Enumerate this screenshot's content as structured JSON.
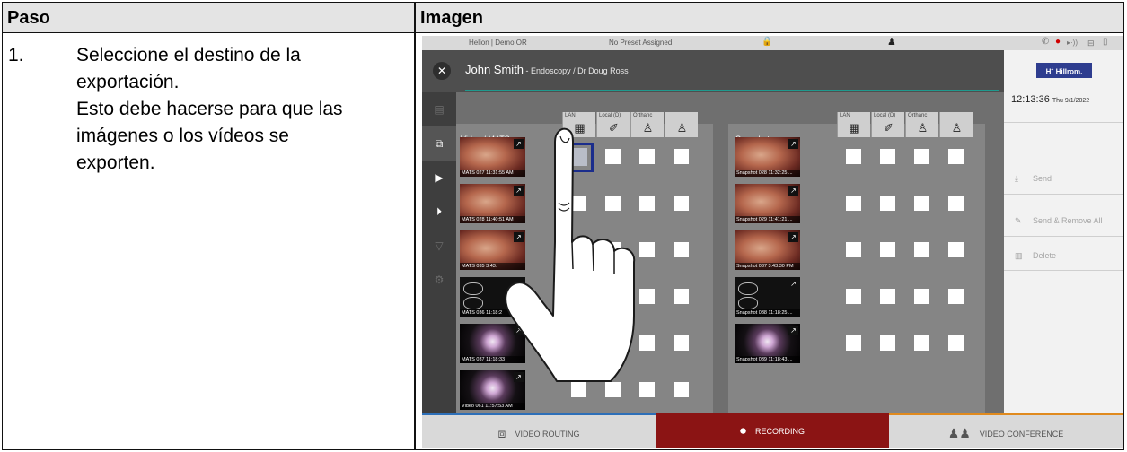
{
  "table": {
    "header_step": "Paso",
    "header_image": "Imagen",
    "step_number": "1.",
    "step_lines": [
      "Seleccione el destino de la",
      "exportación.",
      "Esto debe hacerse para que las",
      "imágenes o los vídeos se",
      "exporten."
    ]
  },
  "screen": {
    "topbar": {
      "location": "Helion | Demo OR",
      "preset": "No Preset Assigned"
    },
    "patient_name": "John Smith",
    "patient_detail": " - Endoscopy / Dr Doug Ross",
    "brand": "Hillrom.",
    "time": "12:13:36",
    "date": "Thu 9/1/2022",
    "actions": [
      {
        "label": "Send",
        "icon": "download-icon"
      },
      {
        "label": "Send & Remove All",
        "icon": "send-remove-icon"
      },
      {
        "label": "Delete",
        "icon": "trash-icon"
      }
    ],
    "video_title": "Video / MATS",
    "snapshots_title": "Snapshots",
    "destinations": [
      "LAN",
      "Local (D)",
      "Orthanc",
      ""
    ],
    "videos": [
      {
        "caption": "MATS 027 11:31:55 AM",
        "kind": "endo"
      },
      {
        "caption": "MATS 028 11:40:51 AM",
        "kind": "endo"
      },
      {
        "caption": "MATS 035 3:43:",
        "kind": "endo"
      },
      {
        "caption": "MATS 036 11:18:2",
        "kind": "ct"
      },
      {
        "caption": "MATS 037 11:18:33",
        "kind": "dark"
      },
      {
        "caption": "Video 061 11:57:53 AM",
        "kind": "dark"
      }
    ],
    "snapshots": [
      {
        "caption": "Snapshot 028 11:32:25 ...",
        "kind": "endo"
      },
      {
        "caption": "Snapshot 029 11:41:21 ...",
        "kind": "endo"
      },
      {
        "caption": "Snapshot 037 3:43:30 PM",
        "kind": "endo"
      },
      {
        "caption": "Snapshot 038 11:18:25 ...",
        "kind": "ct"
      },
      {
        "caption": "Snapshot 039 11:18:43 ...",
        "kind": "dark"
      }
    ],
    "tabs": [
      {
        "label": "VIDEO ROUTING",
        "icon": "video-routing-icon",
        "active": false
      },
      {
        "label": "RECORDING",
        "icon": "recording-icon",
        "active": true
      },
      {
        "label": "VIDEO CONFERENCE",
        "icon": "video-conference-icon",
        "active": false
      }
    ],
    "colors": {
      "active_tab": "#8b1414",
      "selected_frame": "#1b2d8c",
      "accent_line": "#1f9a8e",
      "brand": "#2e3d8f"
    }
  }
}
